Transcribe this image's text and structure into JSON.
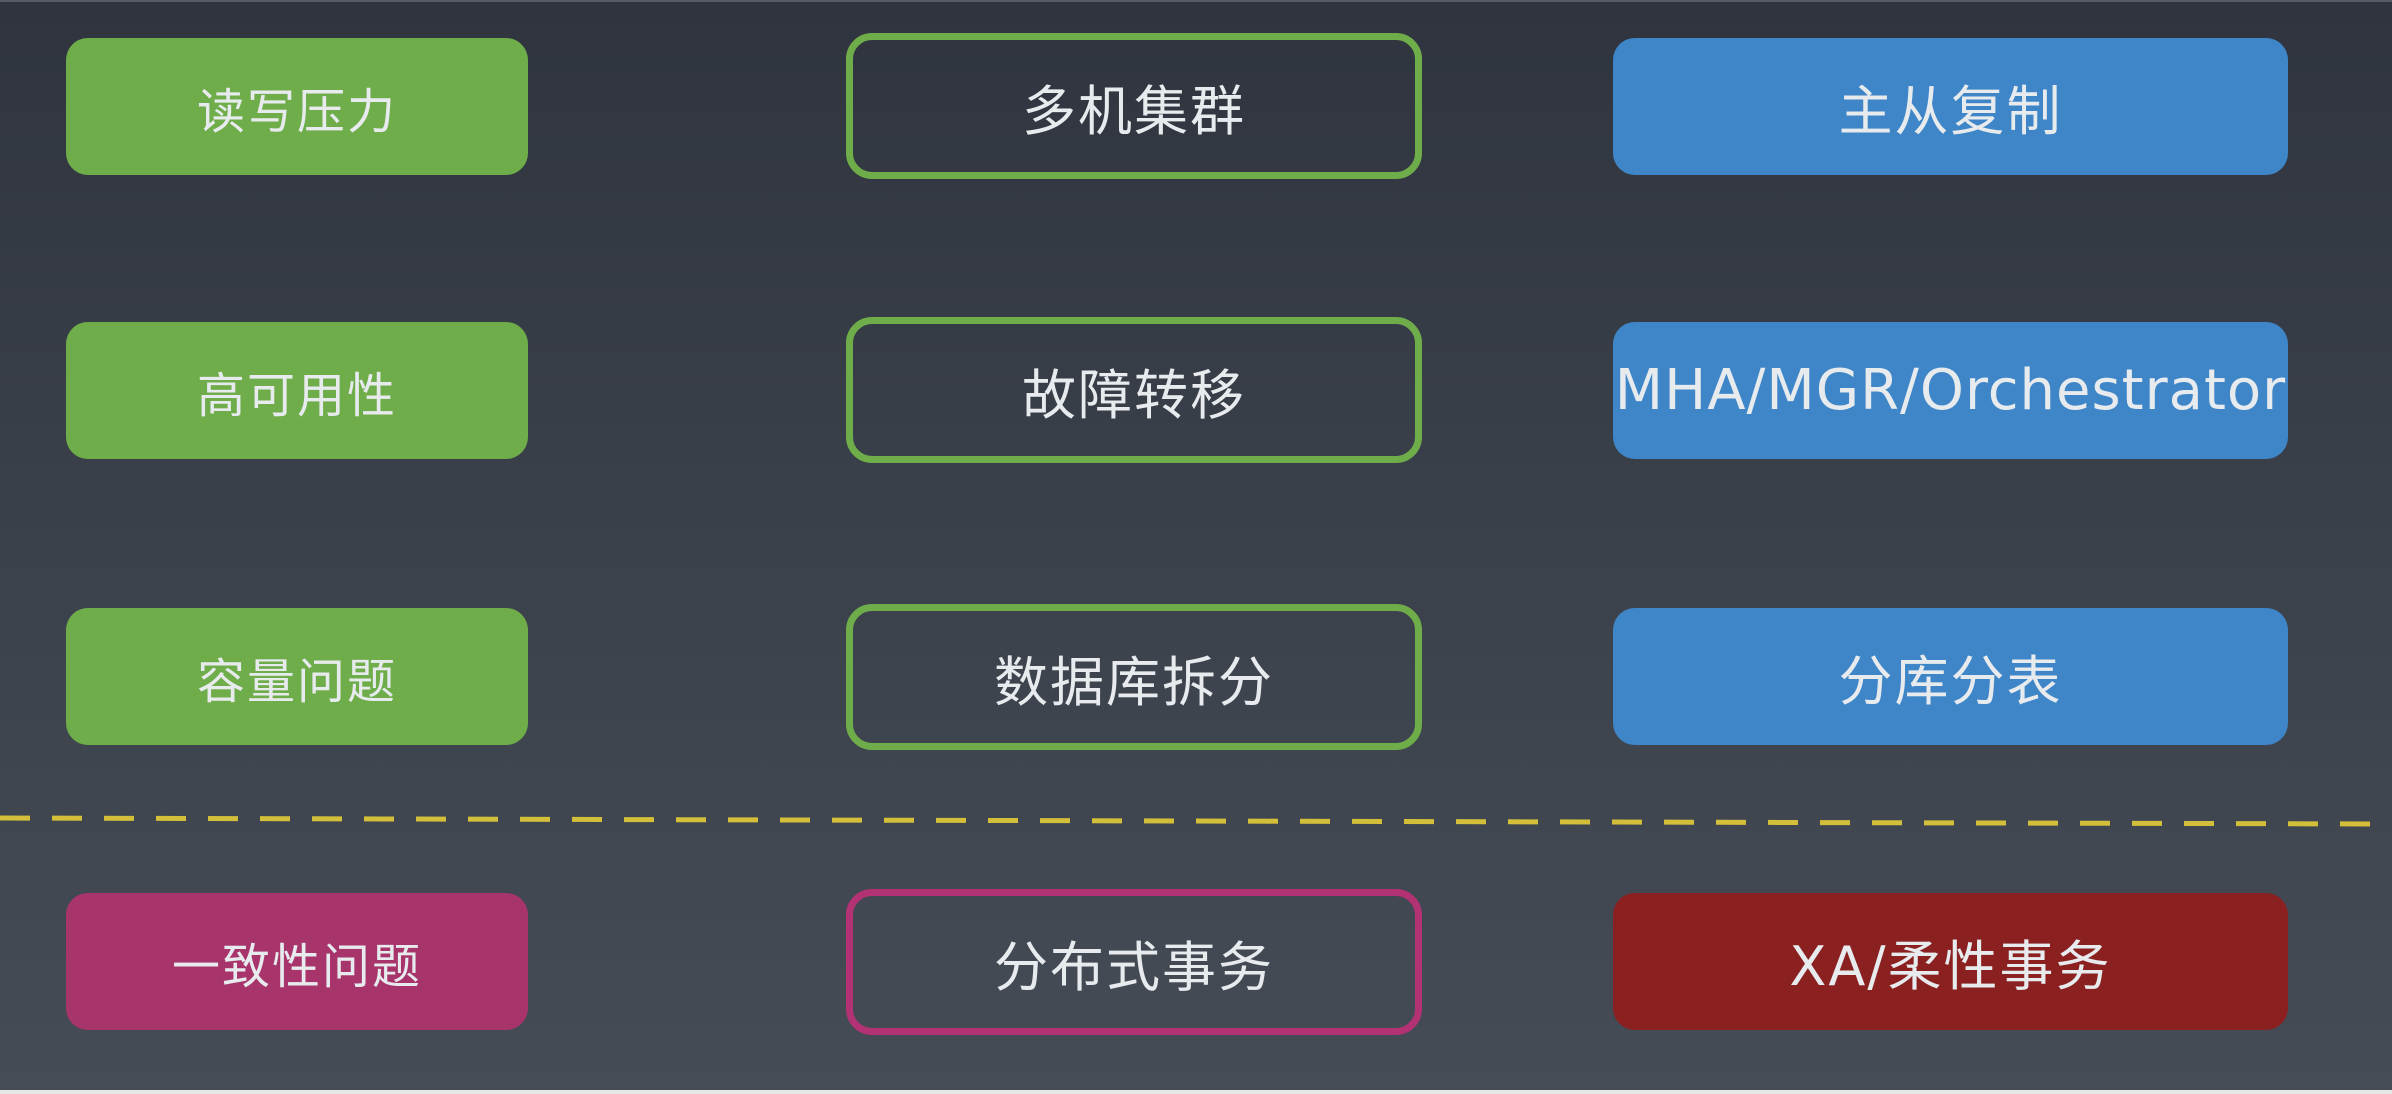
{
  "colors": {
    "green": "#6fad4b",
    "blue": "#3e86c8",
    "magenta": "#a8346c",
    "crimson": "#8a2020",
    "magenta_border": "#b23273",
    "divider": "#d3bf3a"
  },
  "rows": [
    {
      "problem": "读写压力",
      "approach": "多机集群",
      "solution": "主从复制"
    },
    {
      "problem": "高可用性",
      "approach": "故障转移",
      "solution": "MHA/MGR/Orchestrator"
    },
    {
      "problem": "容量问题",
      "approach": "数据库拆分",
      "solution": "分库分表"
    },
    {
      "problem": "一致性问题",
      "approach": "分布式事务",
      "solution": "XA/柔性事务"
    }
  ]
}
